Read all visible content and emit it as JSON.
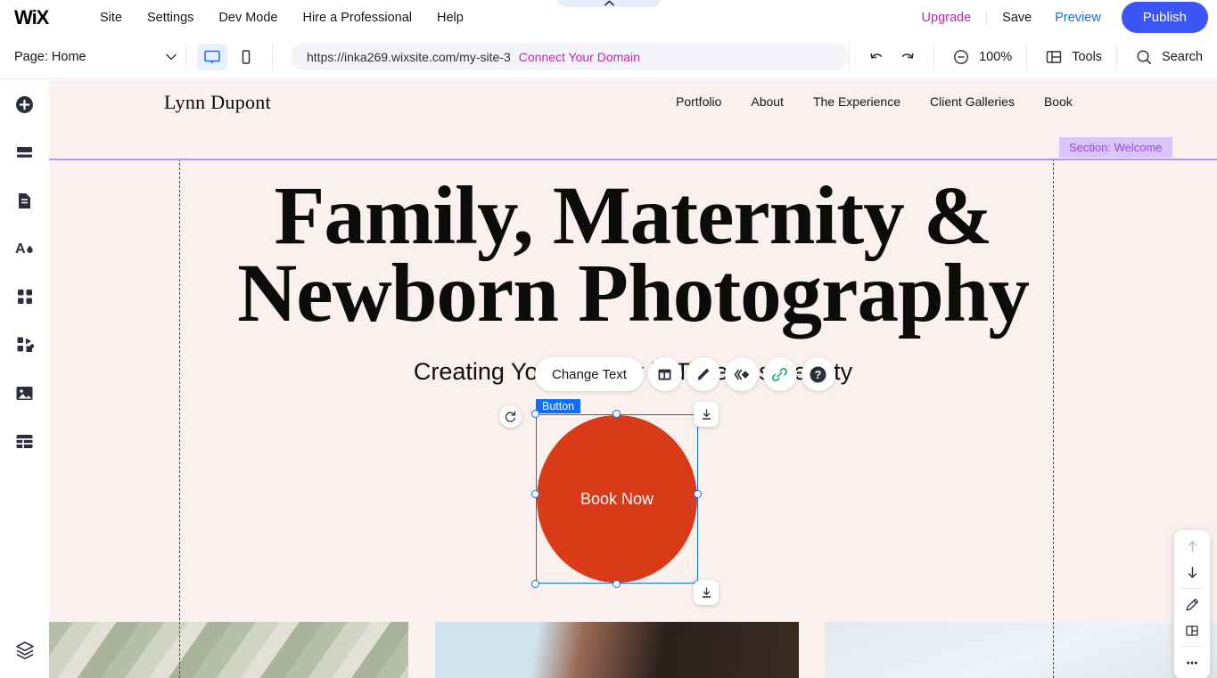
{
  "app": {
    "logo_text": "WiX",
    "top_menu": [
      {
        "label": "Site"
      },
      {
        "label": "Settings"
      },
      {
        "label": "Dev Mode"
      },
      {
        "label": "Hire a Professional"
      },
      {
        "label": "Help"
      }
    ],
    "top_actions": {
      "upgrade": "Upgrade",
      "save": "Save",
      "preview": "Preview",
      "publish": "Publish"
    }
  },
  "toolbar": {
    "page_selector": "Page: Home",
    "devices": {
      "desktop": "desktop-view",
      "mobile": "mobile-view"
    },
    "url": "https://inka269.wixsite.com/my-site-3",
    "connect_domain": "Connect Your Domain",
    "undo": "undo",
    "redo": "redo",
    "zoom_level": "100%",
    "tools_label": "Tools",
    "search_label": "Search"
  },
  "sidebar": {
    "items": [
      {
        "name": "add-elements",
        "icon": "plus-circle-icon"
      },
      {
        "name": "add-section",
        "icon": "sections-icon"
      },
      {
        "name": "pages-menu",
        "icon": "page-icon"
      },
      {
        "name": "site-design",
        "icon": "theme-droplet-icon"
      },
      {
        "name": "apps",
        "icon": "apps-grid-icon"
      },
      {
        "name": "add-ons",
        "icon": "puzzle-icon"
      },
      {
        "name": "media",
        "icon": "image-icon"
      },
      {
        "name": "cms",
        "icon": "table-icon"
      }
    ],
    "bottom": {
      "name": "layers",
      "icon": "layers-icon"
    }
  },
  "site": {
    "brand": "Lynn Dupont",
    "nav": [
      {
        "label": "Portfolio"
      },
      {
        "label": "About"
      },
      {
        "label": "The Experience"
      },
      {
        "label": "Client Galleries"
      },
      {
        "label": "Book"
      }
    ],
    "section_badge": "Section: Welcome",
    "heading_line1": "Family, Maternity &",
    "heading_line2": "Newborn Photography",
    "subheading": "Creating Your Legacy in Timeless Beauty"
  },
  "text_toolbar": {
    "change_text": "Change Text",
    "icons": [
      {
        "name": "layout-icon"
      },
      {
        "name": "design-brush-icon"
      },
      {
        "name": "animation-icon"
      },
      {
        "name": "link-icon"
      },
      {
        "name": "help-icon"
      }
    ]
  },
  "selection": {
    "label": "Button",
    "button_text": "Book Now",
    "button_color": "#d93a18",
    "selection_color": "#116dff",
    "rotate_handle": "rotate-icon",
    "dock_top": "dock-top-icon",
    "dock_bottom": "dock-bottom-icon"
  },
  "right_toolbar": {
    "items": [
      {
        "name": "move-up",
        "icon": "arrow-up-icon",
        "disabled": true
      },
      {
        "name": "move-down",
        "icon": "arrow-down-icon",
        "disabled": false
      },
      {
        "name": "edit-section",
        "icon": "pencil-icon",
        "disabled": false
      },
      {
        "name": "section-layout",
        "icon": "layout-split-icon",
        "disabled": false
      },
      {
        "name": "more-options",
        "icon": "ellipsis-icon",
        "disabled": false
      }
    ]
  },
  "colors": {
    "canvas_bg": "#faf0ee",
    "accent_blue": "#116dff",
    "publish_blue": "#3b55f6",
    "magenta": "#c724b1",
    "section_purple": "#9a46f5",
    "section_badge_bg": "#dac4fb"
  }
}
